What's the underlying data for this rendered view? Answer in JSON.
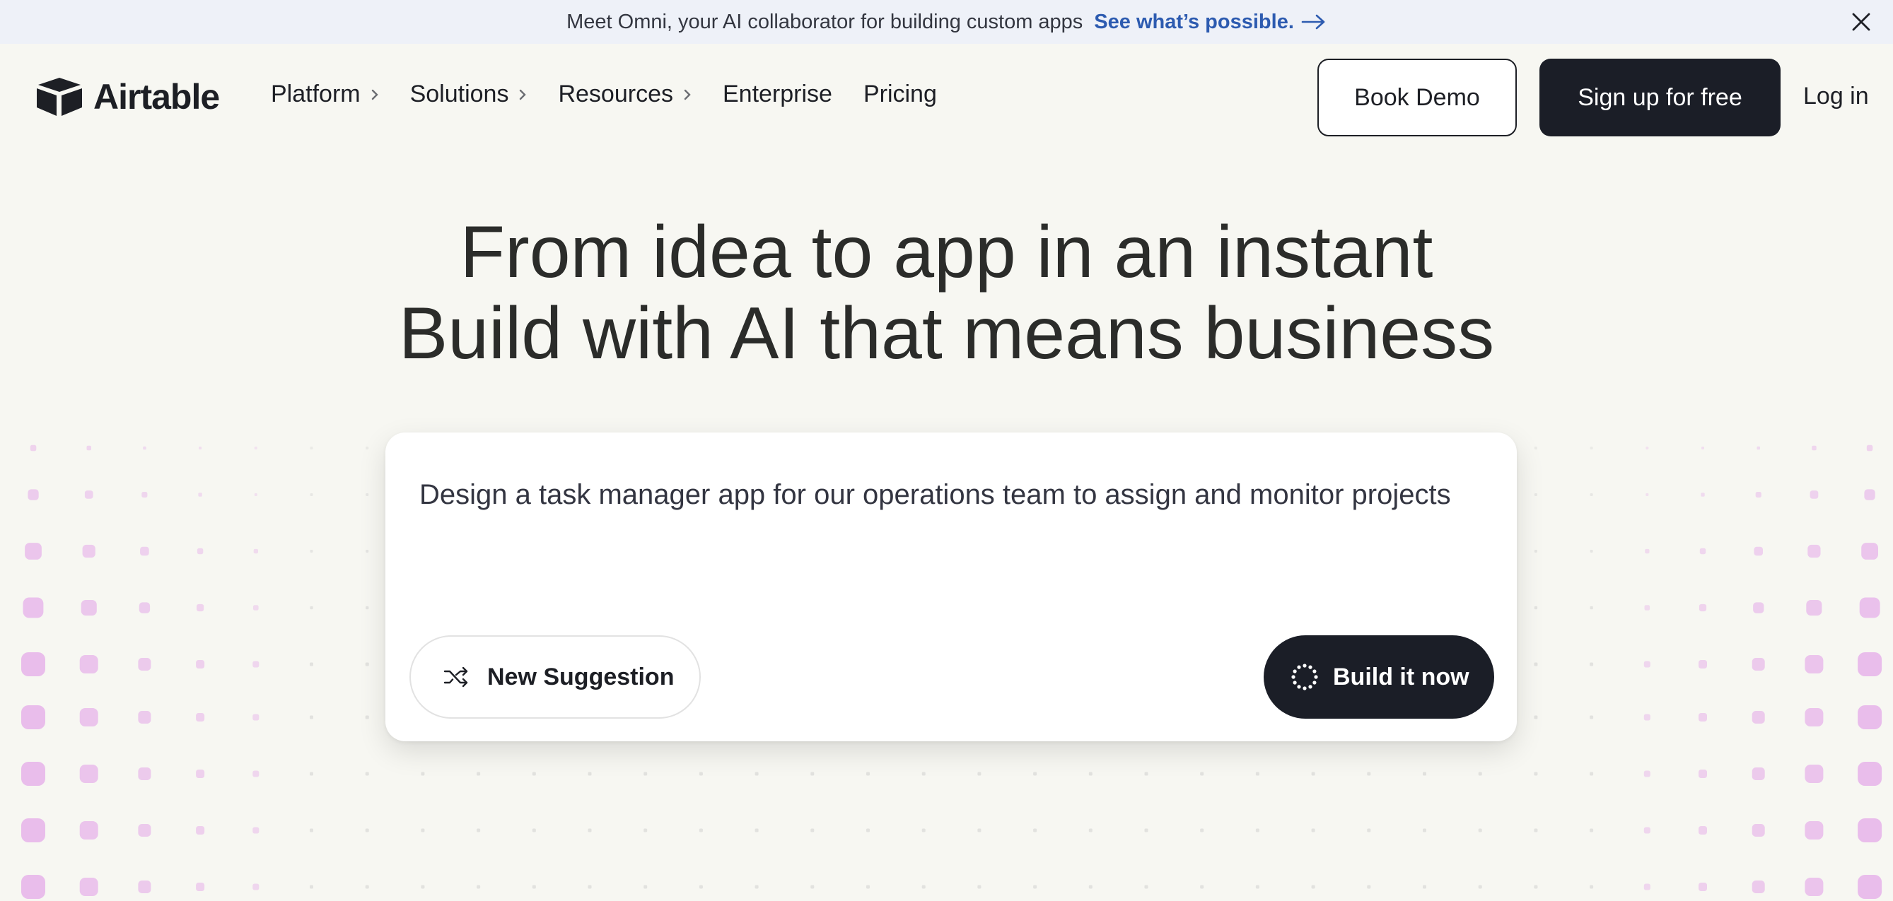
{
  "announcement": {
    "message": "Meet Omni, your AI collaborator for building custom apps",
    "link_text": "See what’s possible.",
    "link_icon": "arrow-right-icon",
    "close_icon": "close-icon"
  },
  "header": {
    "logo_text": "Airtable",
    "logo_icon": "airtable-box-icon",
    "menu": [
      {
        "label": "Platform",
        "has_chevron": true
      },
      {
        "label": "Solutions",
        "has_chevron": true
      },
      {
        "label": "Resources",
        "has_chevron": true
      },
      {
        "label": "Enterprise",
        "has_chevron": false
      },
      {
        "label": "Pricing",
        "has_chevron": false
      }
    ],
    "book_demo": "Book Demo",
    "signup": "Sign up for free",
    "login": "Log in"
  },
  "hero": {
    "title_line1": "From idea to app in an instant",
    "title_line2": "Build with AI that means business"
  },
  "prompt": {
    "text": "Design a task manager app for our operations team to assign and monitor projects",
    "suggestion_button": "New Suggestion",
    "suggestion_icon": "shuffle-icon",
    "build_button": "Build it now",
    "build_icon": "loading-spinner-icon"
  },
  "colors": {
    "background": "#f7f7f2",
    "announcement_bg": "#eef1f8",
    "link": "#2d5bb0",
    "dark_button": "#1b1e27",
    "dot_pink": "#e7b6ea"
  }
}
